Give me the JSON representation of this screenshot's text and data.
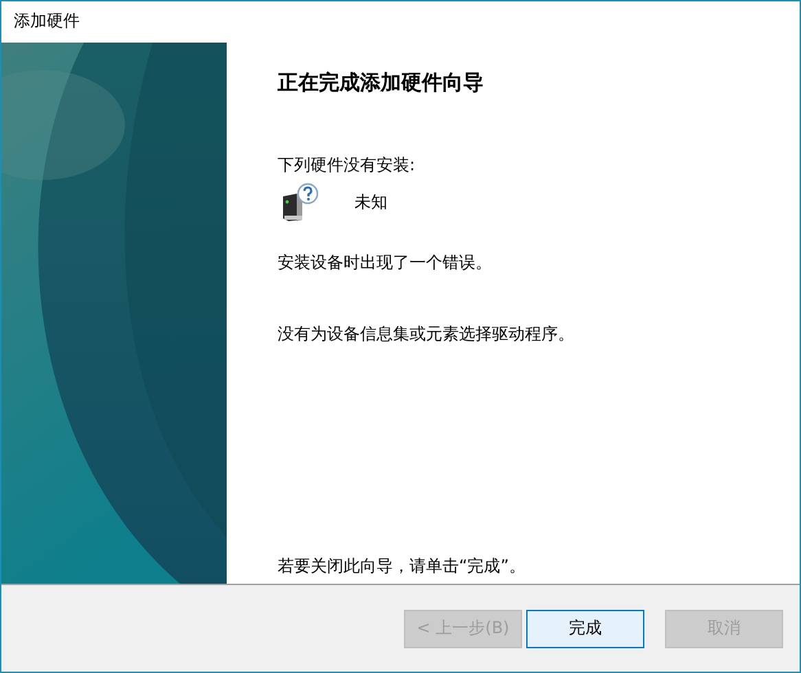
{
  "window": {
    "title": "添加硬件"
  },
  "wizard": {
    "heading": "正在完成添加硬件向导",
    "not_installed_label": "下列硬件没有安装:",
    "devices": [
      {
        "name": "未知"
      }
    ],
    "error_message": "安装设备时出现了一个错误。",
    "detail_message": "没有为设备信息集或元素选择驱动程序。",
    "close_hint": "若要关闭此向导，请单击“完成”。"
  },
  "buttons": [
    {
      "label": "< 上一步(B)",
      "disabled": true,
      "default": false
    },
    {
      "label": "完成",
      "disabled": false,
      "default": true
    },
    {
      "label": "取消",
      "disabled": true,
      "default": false
    }
  ]
}
